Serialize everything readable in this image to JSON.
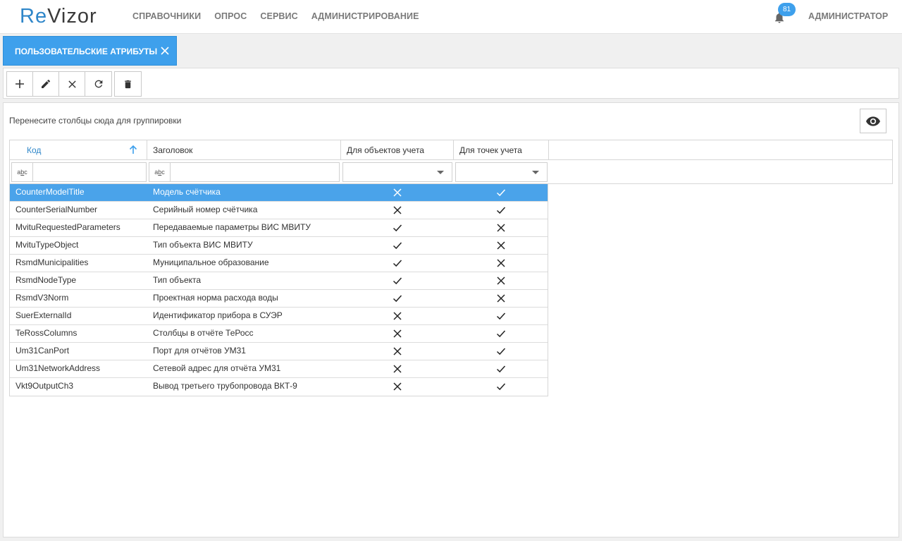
{
  "app": {
    "logo_prefix": "Re",
    "logo_suffix": "Vizor"
  },
  "nav": {
    "items": [
      "СПРАВОЧНИКИ",
      "ОПРОС",
      "СЕРВИС",
      "АДМИНИСТРИРОВАНИЕ"
    ],
    "notification_count": "81",
    "user": "АДМИНИСТРАТОР"
  },
  "tab": {
    "label": "ПОЛЬЗОВАТЕЛЬСКИЕ АТРИБУТЫ"
  },
  "toolbar": {
    "buttons": [
      "plus-icon",
      "pencil-icon",
      "close-icon",
      "refresh-icon",
      "trash-icon"
    ]
  },
  "grid": {
    "group_hint": "Перенесите столбцы сюда для группировки",
    "columns": [
      "Код",
      "Заголовок",
      "Для объектов учета",
      "Для точек учета"
    ],
    "sort_column": "Код",
    "sort_direction": "ascending",
    "rows": [
      {
        "code": "CounterModelTitle",
        "title": "Модель счётчика",
        "for_objects": false,
        "for_points": true,
        "selected": true
      },
      {
        "code": "CounterSerialNumber",
        "title": "Серийный номер счётчика",
        "for_objects": false,
        "for_points": true
      },
      {
        "code": "MvituRequestedParameters",
        "title": "Передаваемые параметры ВИС МВИТУ",
        "for_objects": true,
        "for_points": false
      },
      {
        "code": "MvituTypeObject",
        "title": "Тип объекта ВИС МВИТУ",
        "for_objects": true,
        "for_points": false
      },
      {
        "code": "RsmdMunicipalities",
        "title": "Муниципальное образование",
        "for_objects": true,
        "for_points": false
      },
      {
        "code": "RsmdNodeType",
        "title": "Тип объекта",
        "for_objects": true,
        "for_points": false
      },
      {
        "code": "RsmdV3Norm",
        "title": "Проектная норма расхода воды",
        "for_objects": true,
        "for_points": false
      },
      {
        "code": "SuerExternalId",
        "title": "Идентификатор прибора в СУЭР",
        "for_objects": false,
        "for_points": true
      },
      {
        "code": "TeRossColumns",
        "title": "Столбцы в отчёте ТеРосс",
        "for_objects": false,
        "for_points": true
      },
      {
        "code": "Um31CanPort",
        "title": "Порт для отчётов УМ31",
        "for_objects": false,
        "for_points": true
      },
      {
        "code": "Um31NetworkAddress",
        "title": "Сетевой адрес для отчёта УМ31",
        "for_objects": false,
        "for_points": true
      },
      {
        "code": "Vkt9OutputCh3",
        "title": "Вывод третьего трубопровода ВКТ-9",
        "for_objects": false,
        "for_points": true
      }
    ]
  },
  "colors": {
    "accent": "#3ea0ec",
    "selected_row": "#4aa3ea",
    "logo_blue": "#2e86c9"
  }
}
